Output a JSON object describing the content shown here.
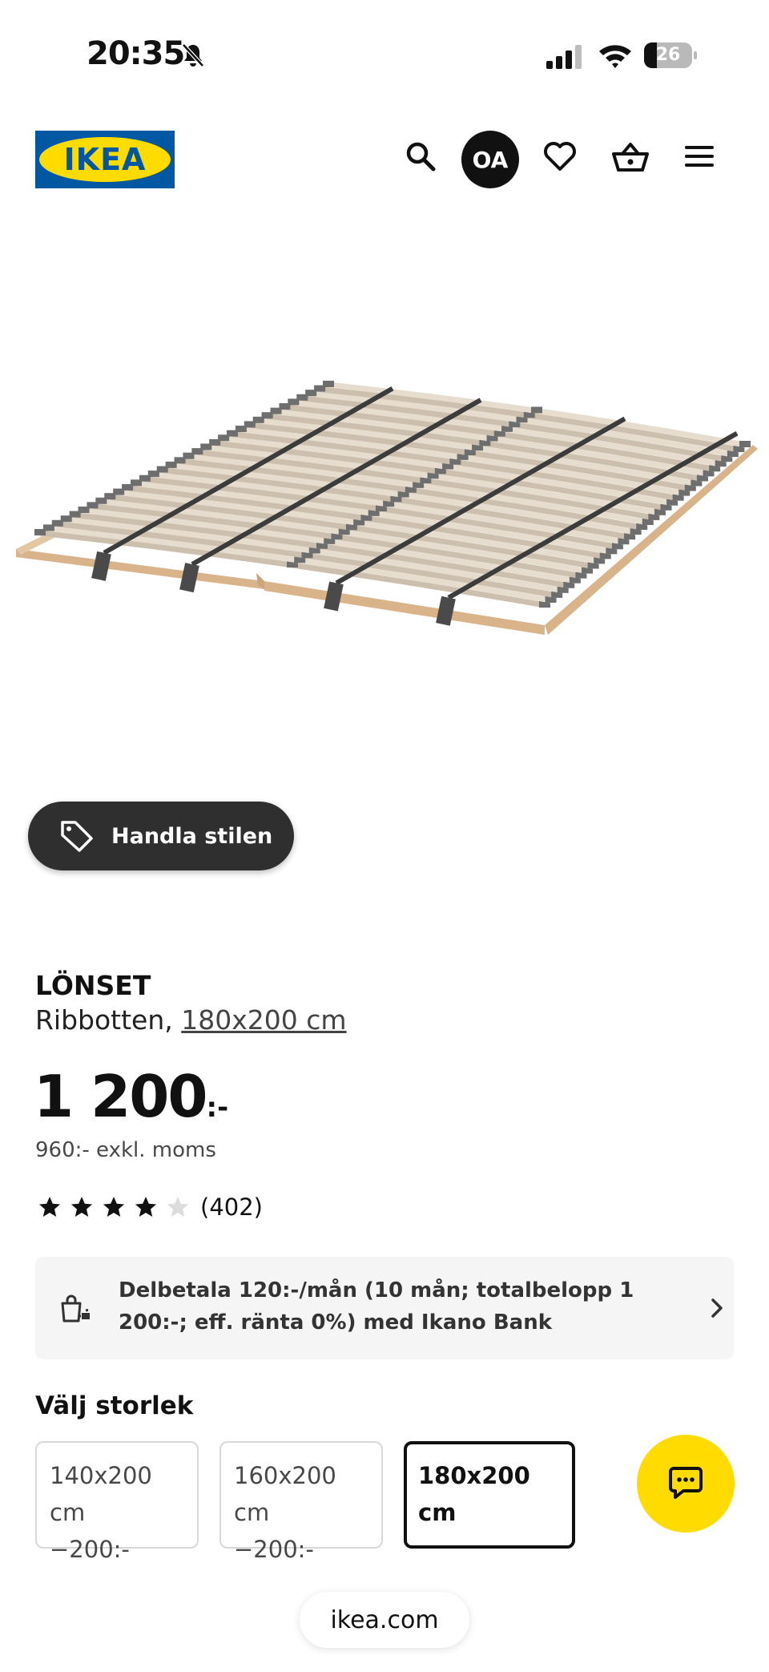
{
  "status_bar": {
    "time": "20:35",
    "battery_level": "26",
    "icons": [
      "bell-muted-icon",
      "cellular-signal-icon",
      "wifi-icon",
      "battery-icon"
    ]
  },
  "header": {
    "logo_text": "IKEA",
    "avatar_initials": "OA",
    "icons": [
      "search-icon",
      "heart-icon",
      "basket-icon",
      "menu-icon"
    ]
  },
  "colors": {
    "brand_blue": "#0058a3",
    "brand_yellow": "#ffdb00",
    "dark_pill": "#2f2f2f"
  },
  "shop_style_button": {
    "label": "Handla stilen",
    "icon": "tag-icon"
  },
  "product": {
    "name": "LÖNSET",
    "type": "Ribbotten,",
    "size_link": "180x200 cm",
    "price": "1 200",
    "price_suffix": ":-",
    "price_excl_vat": "960:- exkl. moms",
    "rating": 4,
    "rating_max": 5,
    "review_count": "(402)"
  },
  "financing": {
    "text": "Delbetala 120:-/mån (10 mån; totalbelopp 1 200:-; eff. ränta 0%) med Ikano Bank",
    "icon": "payment-bag-icon"
  },
  "size_selection": {
    "title": "Välj storlek",
    "options": [
      {
        "label": "140x200 cm",
        "price_diff": "−200:-"
      },
      {
        "label": "160x200 cm",
        "price_diff": "−200:-"
      },
      {
        "label": "180x200 cm",
        "price_diff": ""
      }
    ],
    "selected": "180x200 cm"
  },
  "chat_button": {
    "icon": "chat-icon"
  },
  "browser": {
    "url": "ikea.com"
  }
}
